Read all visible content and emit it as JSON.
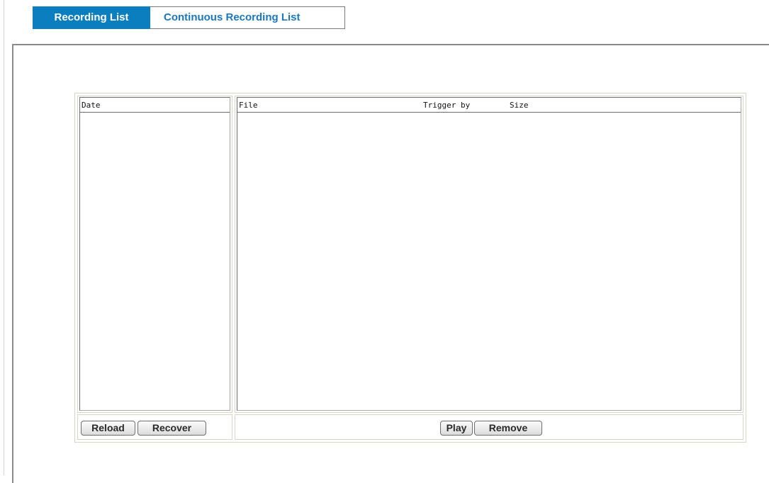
{
  "tabs": [
    {
      "label": "Recording List",
      "active": true
    },
    {
      "label": "Continuous Recording List",
      "active": false
    }
  ],
  "date_list": {
    "header": "Date",
    "items": []
  },
  "file_list": {
    "columns": [
      "File",
      "Trigger by",
      "Size"
    ],
    "rows": []
  },
  "date_buttons": {
    "reload": "Reload",
    "recover": "Recover"
  },
  "file_buttons": {
    "play": "Play",
    "remove": "Remove"
  },
  "colors": {
    "active_tab": "#0b7ec0",
    "inactive_tab_text": "#1a77c2"
  }
}
